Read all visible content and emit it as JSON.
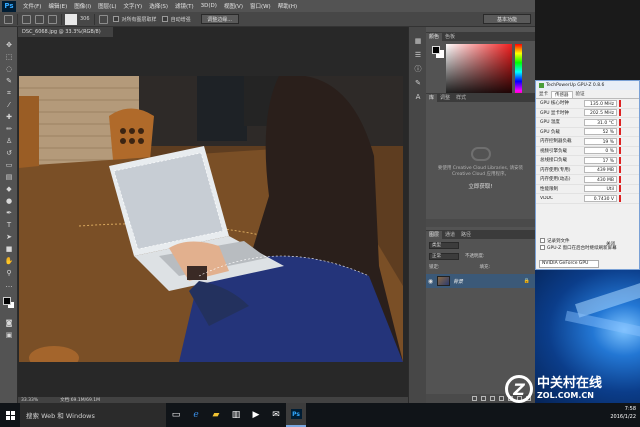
{
  "photoshop": {
    "logo": "Ps",
    "menu": [
      "文件(F)",
      "编辑(E)",
      "图像(I)",
      "图层(L)",
      "文字(Y)",
      "选择(S)",
      "滤镜(T)",
      "3D(D)",
      "视图(V)",
      "窗口(W)",
      "帮助(H)"
    ],
    "options": {
      "brush_size": "306",
      "sample_all_layers": "对所有图层取样",
      "auto_enhance": "自动增强",
      "refine_edge": "调整边缘...",
      "workspace": "基本功能"
    },
    "document_tab": "DSC_6068.jpg @ 33.3%(RGB/8)",
    "status": {
      "zoom": "33.33%",
      "doc_info": "文档:69.1M/69.1M"
    },
    "panels": {
      "color_tabs": [
        "颜色",
        "色板"
      ],
      "library_tabs": [
        "库",
        "调整",
        "样式"
      ],
      "cc_message": "要使用 Creative Cloud Libraries, 请安装 Creative Cloud 应用程序。",
      "cc_status": "立即获取!",
      "layers_tabs": [
        "图层",
        "通道",
        "路径"
      ],
      "blend_mode": "正常",
      "opacity_label": "不透明度:",
      "lock_label": "锁定:",
      "fill_label": "填充:",
      "layer_name": "背景",
      "kind_filter": "类型"
    }
  },
  "gpuz": {
    "title": "TechPowerUp GPU-Z 0.8.6",
    "tabs": [
      "显卡",
      "传感器",
      "验证"
    ],
    "sensors": [
      {
        "label": "GPU 核心时钟",
        "value": "135.0 MHz"
      },
      {
        "label": "GPU 显卡时钟",
        "value": "202.5 MHz"
      },
      {
        "label": "GPU 温度",
        "value": "31.0 °C"
      },
      {
        "label": "GPU 负载",
        "value": "52 %"
      },
      {
        "label": "内存控制器负载",
        "value": "19 %"
      },
      {
        "label": "视频引擎负载",
        "value": "0 %"
      },
      {
        "label": "总线接口负载",
        "value": "17 %"
      },
      {
        "label": "内存使用(专用)",
        "value": "439 MB"
      },
      {
        "label": "内存使用(动态)",
        "value": "430 MB"
      },
      {
        "label": "性能限制",
        "value": "Util"
      },
      {
        "label": "VDDC",
        "value": "0.7430 V"
      }
    ],
    "options": [
      "记录到文件",
      "GPU-Z 窗口在后台时继续刷新屏幕"
    ],
    "close_label": "关闭",
    "gpu_select": "NVIDIA GeForce GPU"
  },
  "watermark": {
    "name_cn": "中关村在线",
    "domain": "ZOL.COM.CN",
    "logo_letter": "Z"
  },
  "taskbar": {
    "search_placeholder": "搜索 Web 和 Windows",
    "time": "7:58",
    "date": "2016/1/22"
  },
  "colors": {
    "ps_accent": "#31a8ff",
    "layer_selected": "#3b5978",
    "desktop_blue": "#2377d4"
  }
}
